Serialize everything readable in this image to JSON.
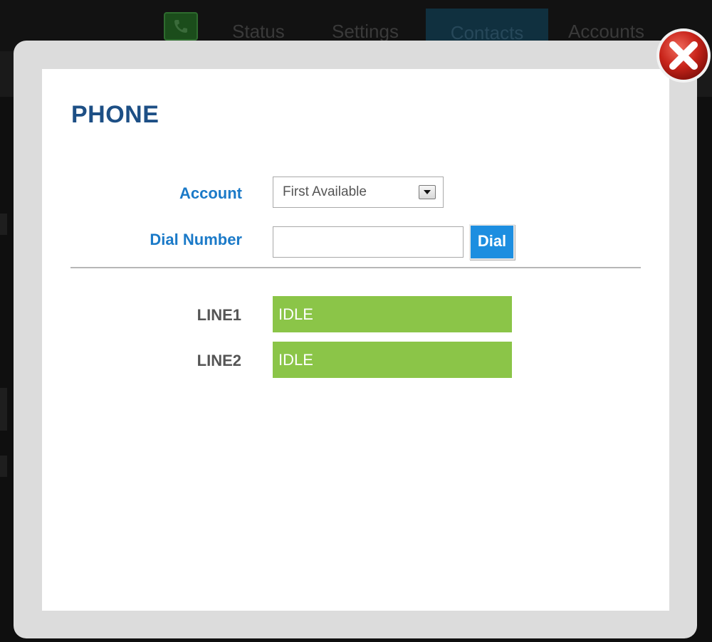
{
  "nav": {
    "tabs": [
      "Status",
      "Settings",
      "Contacts",
      "Accounts"
    ],
    "active_tab": "Contacts",
    "logo_icon": "phone-icon"
  },
  "modal": {
    "title": "PHONE",
    "account": {
      "label": "Account",
      "selected": "First Available"
    },
    "dial": {
      "label": "Dial Number",
      "value": "",
      "button_label": "Dial"
    },
    "lines": [
      {
        "label": "LINE1",
        "status": "IDLE"
      },
      {
        "label": "LINE2",
        "status": "IDLE"
      }
    ],
    "close_icon": "close-icon"
  },
  "colors": {
    "title": "#1d4f85",
    "field_label": "#1b7ac8",
    "dial_button": "#1d8ee0",
    "line_idle": "#8bc548",
    "close_red": "#c8241a"
  }
}
